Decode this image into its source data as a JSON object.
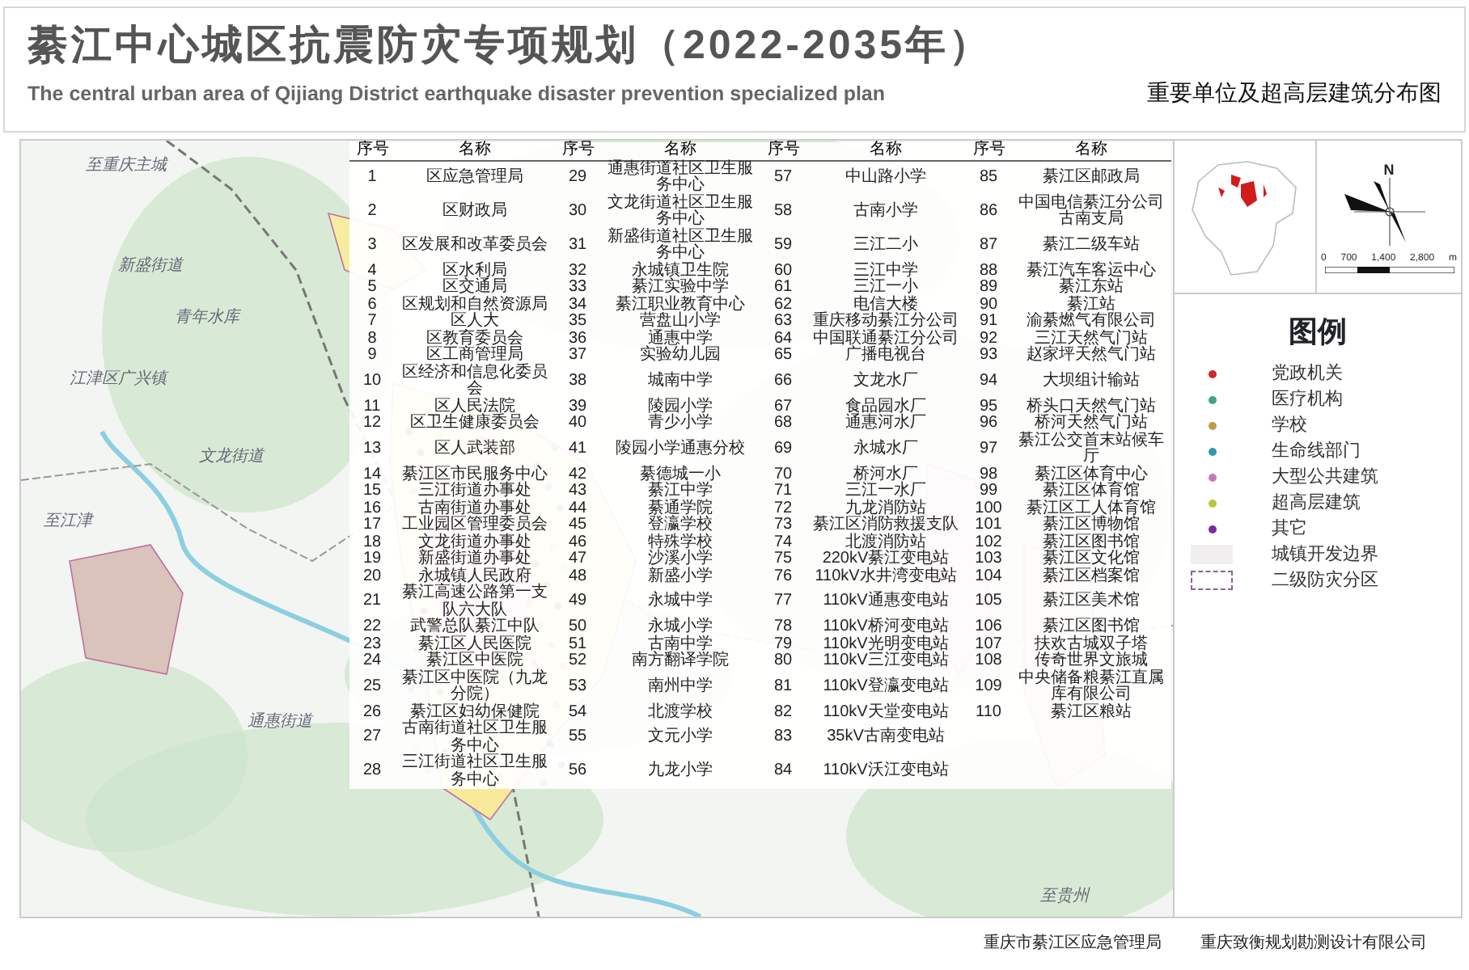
{
  "header": {
    "title": "綦江中心城区抗震防灾专项规划（2022-2035年）",
    "subtitle_en": "The central urban area  of Qijiang District earthquake disaster prevention  specialized plan",
    "map_name": "重要单位及超高层建筑分布图"
  },
  "map": {
    "labels": [
      {
        "text": "至重庆主城"
      },
      {
        "text": "新盛街道"
      },
      {
        "text": "青年水库"
      },
      {
        "text": "江津区广兴镇"
      },
      {
        "text": "文龙街道"
      },
      {
        "text": "通惠街道"
      },
      {
        "text": "至江津"
      },
      {
        "text": "至贵州"
      }
    ]
  },
  "unit_table": {
    "columns": [
      "序号",
      "名称",
      "序号",
      "名称",
      "序号",
      "名称",
      "序号",
      "名称"
    ],
    "rows": [
      [
        "1",
        "区应急管理局",
        "29",
        "通惠街道社区卫生服务中心",
        "57",
        "中山路小学",
        "85",
        "綦江区邮政局"
      ],
      [
        "2",
        "区财政局",
        "30",
        "文龙街道社区卫生服务中心",
        "58",
        "古南小学",
        "86",
        "中国电信綦江分公司古南支局"
      ],
      [
        "3",
        "区发展和改革委员会",
        "31",
        "新盛街道社区卫生服务中心",
        "59",
        "三江二小",
        "87",
        "綦江二级车站"
      ],
      [
        "4",
        "区水利局",
        "32",
        "永城镇卫生院",
        "60",
        "三江中学",
        "88",
        "綦江汽车客运中心"
      ],
      [
        "5",
        "区交通局",
        "33",
        "綦江实验中学",
        "61",
        "三江一小",
        "89",
        "綦江东站"
      ],
      [
        "6",
        "区规划和自然资源局",
        "34",
        "綦江职业教育中心",
        "62",
        "电信大楼",
        "90",
        "綦江站"
      ],
      [
        "7",
        "区人大",
        "35",
        "营盘山小学",
        "63",
        "重庆移动綦江分公司",
        "91",
        "渝綦燃气有限公司"
      ],
      [
        "8",
        "区教育委员会",
        "36",
        "通惠中学",
        "64",
        "中国联通綦江分公司",
        "92",
        "三江天然气门站"
      ],
      [
        "9",
        "区工商管理局",
        "37",
        "实验幼儿园",
        "65",
        "广播电视台",
        "93",
        "赵家坪天然气门站"
      ],
      [
        "10",
        "区经济和信息化委员会",
        "38",
        "城南中学",
        "66",
        "文龙水厂",
        "94",
        "大坝组计输站"
      ],
      [
        "11",
        "区人民法院",
        "39",
        "陵园小学",
        "67",
        "食品园水厂",
        "95",
        "桥头口天然气门站"
      ],
      [
        "12",
        "区卫生健康委员会",
        "40",
        "青少小学",
        "68",
        "通惠河水厂",
        "96",
        "桥河天然气门站"
      ],
      [
        "13",
        "区人武装部",
        "41",
        "陵园小学通惠分校",
        "69",
        "永城水厂",
        "97",
        "綦江公交首末站候车厅"
      ],
      [
        "14",
        "綦江区市民服务中心",
        "42",
        "綦德城一小",
        "70",
        "桥河水厂",
        "98",
        "綦江区体育中心"
      ],
      [
        "15",
        "三江街道办事处",
        "43",
        "綦江中学",
        "71",
        "三江一水厂",
        "99",
        "綦江区体育馆"
      ],
      [
        "16",
        "古南街道办事处",
        "44",
        "綦通学院",
        "72",
        "九龙消防站",
        "100",
        "綦江区工人体育馆"
      ],
      [
        "17",
        "工业园区管理委员会",
        "45",
        "登瀛学校",
        "73",
        "綦江区消防救援支队",
        "101",
        "綦江区博物馆"
      ],
      [
        "18",
        "文龙街道办事处",
        "46",
        "特殊学校",
        "74",
        "北渡消防站",
        "102",
        "綦江区图书馆"
      ],
      [
        "19",
        "新盛街道办事处",
        "47",
        "沙溪小学",
        "75",
        "220kV綦江变电站",
        "103",
        "綦江区文化馆"
      ],
      [
        "20",
        "永城镇人民政府",
        "48",
        "新盛小学",
        "76",
        "110kV水井湾变电站",
        "104",
        "綦江区档案馆"
      ],
      [
        "21",
        "綦江高速公路第一支队六大队",
        "49",
        "永城中学",
        "77",
        "110kV通惠变电站",
        "105",
        "綦江区美术馆"
      ],
      [
        "22",
        "武警总队綦江中队",
        "50",
        "永城小学",
        "78",
        "110kV桥河变电站",
        "106",
        "綦江区图书馆"
      ],
      [
        "23",
        "綦江区人民医院",
        "51",
        "古南中学",
        "79",
        "110kV光明变电站",
        "107",
        "扶欢古城双子塔"
      ],
      [
        "24",
        "綦江区中医院",
        "52",
        "南方翻译学院",
        "80",
        "110kV三江变电站",
        "108",
        "传奇世界文旅城"
      ],
      [
        "25",
        "綦江区中医院（九龙分院）",
        "53",
        "南州中学",
        "81",
        "110kV登瀛变电站",
        "109",
        "中央储备粮綦江直属库有限公司"
      ],
      [
        "26",
        "綦江区妇幼保健院",
        "54",
        "北渡学校",
        "82",
        "110kV天堂变电站",
        "110",
        "綦江区粮站"
      ],
      [
        "27",
        "古南街道社区卫生服务中心",
        "55",
        "文元小学",
        "83",
        "35kV古南变电站"
      ],
      [
        "28",
        "三江街道社区卫生服务中心",
        "56",
        "九龙小学",
        "84",
        "110kV沃江变电站"
      ]
    ]
  },
  "inset": {
    "north_label": "N",
    "scale_labels": [
      "0",
      "700",
      "1,400",
      "2,800",
      "m"
    ]
  },
  "legend": {
    "title": "图例",
    "items": [
      {
        "label": "党政机关",
        "kind": "dot",
        "color": "#d02828"
      },
      {
        "label": "医疗机构",
        "kind": "dot",
        "color": "#3caa78"
      },
      {
        "label": "学校",
        "kind": "dot",
        "color": "#c09a48"
      },
      {
        "label": "生命线部门",
        "kind": "dot",
        "color": "#2e98b0"
      },
      {
        "label": "大型公共建筑",
        "kind": "dot",
        "color": "#c878b8"
      },
      {
        "label": "超高层建筑",
        "kind": "dot",
        "color": "#b8c838"
      },
      {
        "label": "其它",
        "kind": "dot",
        "color": "#7a2aa0"
      },
      {
        "label": "城镇开发边界",
        "kind": "area"
      },
      {
        "label": "二级防灾分区",
        "kind": "boundary"
      }
    ]
  },
  "footer": [
    "重庆市綦江区应急管理局",
    "重庆致衡规划勘测设计有限公司"
  ]
}
